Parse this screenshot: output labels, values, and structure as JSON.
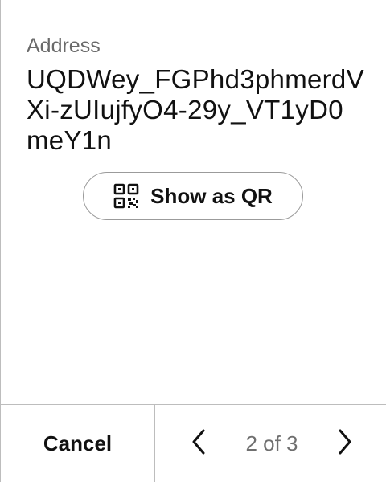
{
  "address": {
    "label": "Address",
    "value": "UQDWey_FGPhd3phmerdVXi-zUIujfyO4-29y_VT1yD0meY1n"
  },
  "qr_button": {
    "label": "Show as QR",
    "icon": "qr-code-icon"
  },
  "footer": {
    "cancel_label": "Cancel",
    "page_indicator": "2 of 3",
    "prev_icon": "chevron-left-icon",
    "next_icon": "chevron-right-icon"
  }
}
